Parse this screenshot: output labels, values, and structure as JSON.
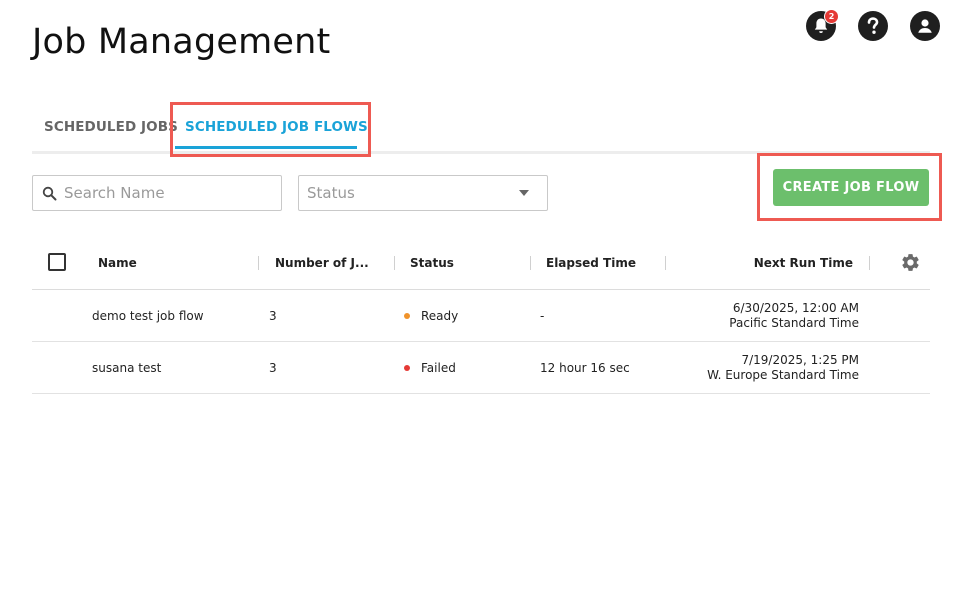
{
  "page": {
    "title": "Job Management"
  },
  "header_icons": {
    "notification_count": "2",
    "icons": [
      "bell-icon",
      "help-icon",
      "account-icon"
    ]
  },
  "tabs": [
    {
      "label": "SCHEDULED JOBS",
      "active": false
    },
    {
      "label": "SCHEDULED JOB FLOWS",
      "active": true
    }
  ],
  "filters": {
    "search_placeholder": "Search Name",
    "status_placeholder": "Status"
  },
  "actions": {
    "create_label": "CREATE JOB FLOW"
  },
  "table": {
    "columns": [
      "Name",
      "Number of J...",
      "Status",
      "Elapsed Time",
      "Next Run Time"
    ],
    "rows": [
      {
        "name": "demo test job flow",
        "number_of_jobs": "3",
        "status": "Ready",
        "status_color": "#f0932b",
        "elapsed": "-",
        "next_run_date": "6/30/2025, 12:00 AM",
        "next_run_tz": "Pacific Standard Time"
      },
      {
        "name": "susana test",
        "number_of_jobs": "3",
        "status": "Failed",
        "status_color": "#e53935",
        "elapsed": "12 hour 16 sec",
        "next_run_date": "7/19/2025, 1:25 PM",
        "next_run_tz": "W. Europe Standard Time"
      }
    ]
  },
  "colors": {
    "accent": "#1aa3d8",
    "create_button": "#6cbf6c",
    "highlight": "#ee5a52"
  }
}
